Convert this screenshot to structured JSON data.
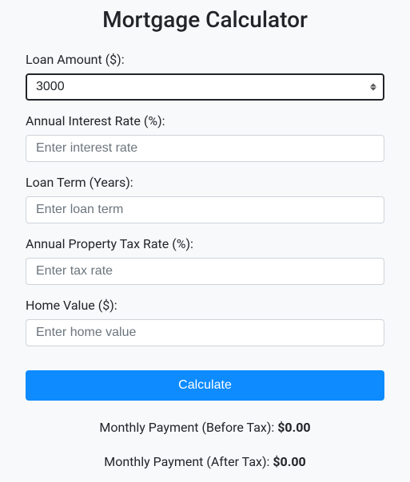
{
  "title": "Mortgage Calculator",
  "fields": {
    "loanAmount": {
      "label": "Loan Amount ($):",
      "value": "3000",
      "placeholder": ""
    },
    "interestRate": {
      "label": "Annual Interest Rate (%):",
      "value": "",
      "placeholder": "Enter interest rate"
    },
    "loanTerm": {
      "label": "Loan Term (Years):",
      "value": "",
      "placeholder": "Enter loan term"
    },
    "taxRate": {
      "label": "Annual Property Tax Rate (%):",
      "value": "",
      "placeholder": "Enter tax rate"
    },
    "homeValue": {
      "label": "Home Value ($):",
      "value": "",
      "placeholder": "Enter home value"
    }
  },
  "calculateButton": "Calculate",
  "results": {
    "beforeTax": {
      "label": "Monthly Payment (Before Tax): ",
      "value": "$0.00"
    },
    "afterTax": {
      "label": "Monthly Payment (After Tax): ",
      "value": "$0.00"
    }
  }
}
